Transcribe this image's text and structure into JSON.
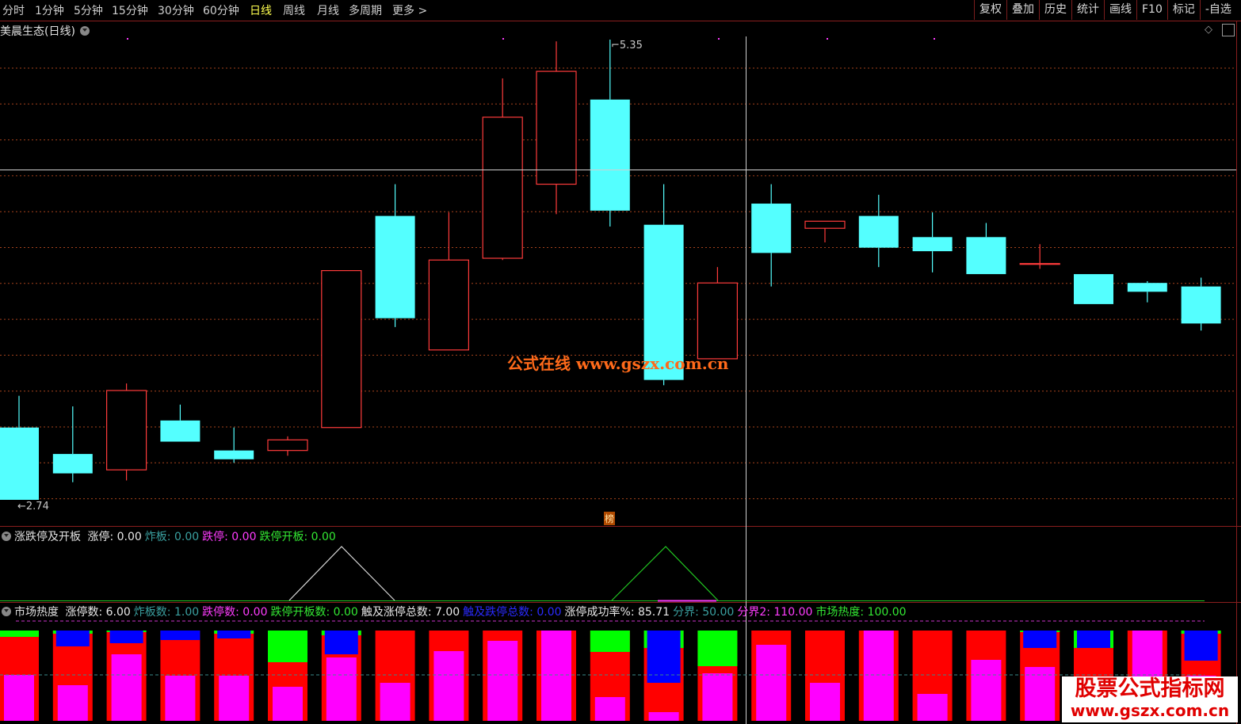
{
  "toolbar": {
    "periods": [
      "分时",
      "1分钟",
      "5分钟",
      "15分钟",
      "30分钟",
      "60分钟",
      "日线",
      "周线",
      "月线",
      "多周期",
      "更多 >"
    ],
    "active_index": 6,
    "right_buttons": [
      "复权",
      "叠加",
      "历史",
      "统计",
      "画线",
      "F10",
      "标记",
      "-自选"
    ]
  },
  "main": {
    "stock_title": "美晨生态(日线)",
    "high_label": "5.35",
    "low_label": "2.74",
    "watermark": "公式在线  www.gszx.com.cn",
    "badge": "榜",
    "colors": {
      "up": "#ff3b3b",
      "down": "#54ffff",
      "grid": "#a5421c"
    }
  },
  "candles": [
    {
      "o": 3.15,
      "c": 2.74,
      "h": 3.33,
      "l": 2.74
    },
    {
      "o": 3.0,
      "c": 2.89,
      "h": 3.27,
      "l": 2.84
    },
    {
      "o": 2.91,
      "c": 3.36,
      "h": 3.4,
      "l": 2.85
    },
    {
      "o": 3.19,
      "c": 3.07,
      "h": 3.28,
      "l": 3.07
    },
    {
      "o": 3.02,
      "c": 2.97,
      "h": 3.15,
      "l": 2.95
    },
    {
      "o": 3.02,
      "c": 3.08,
      "h": 3.1,
      "l": 2.99
    },
    {
      "o": 3.15,
      "c": 4.04,
      "h": 4.04,
      "l": 3.15
    },
    {
      "o": 4.35,
      "c": 3.77,
      "h": 4.53,
      "l": 3.72
    },
    {
      "o": 3.59,
      "c": 4.1,
      "h": 4.37,
      "l": 3.59
    },
    {
      "o": 4.11,
      "c": 4.91,
      "h": 5.13,
      "l": 4.1
    },
    {
      "o": 4.53,
      "c": 5.17,
      "h": 5.34,
      "l": 4.36
    },
    {
      "o": 5.01,
      "c": 4.38,
      "h": 5.35,
      "l": 4.29
    },
    {
      "o": 4.3,
      "c": 3.42,
      "h": 4.53,
      "l": 3.39
    },
    {
      "o": 3.54,
      "c": 3.97,
      "h": 4.06,
      "l": 3.54
    },
    {
      "o": 4.42,
      "c": 4.14,
      "h": 4.53,
      "l": 3.95
    },
    {
      "o": 4.28,
      "c": 4.32,
      "h": 4.32,
      "l": 4.2
    },
    {
      "o": 4.35,
      "c": 4.17,
      "h": 4.47,
      "l": 4.06
    },
    {
      "o": 4.23,
      "c": 4.15,
      "h": 4.37,
      "l": 4.03
    },
    {
      "o": 4.23,
      "c": 4.02,
      "h": 4.31,
      "l": 4.02
    },
    {
      "o": 4.08,
      "c": 4.08,
      "h": 4.19,
      "l": 4.05
    },
    {
      "o": 4.02,
      "c": 3.85,
      "h": 4.02,
      "l": 3.85
    },
    {
      "o": 3.97,
      "c": 3.92,
      "h": 3.98,
      "l": 3.86
    },
    {
      "o": 3.95,
      "c": 3.74,
      "h": 4.0,
      "l": 3.7
    }
  ],
  "indicator1": {
    "name": "涨跌停及开板",
    "items": [
      {
        "label": "涨停: ",
        "value": "0.00",
        "color": "#e8e8e8"
      },
      {
        "label": "炸板: ",
        "value": "0.00",
        "color": "#3aa0a0"
      },
      {
        "label": "跌停: ",
        "value": "0.00",
        "color": "#ff3cff"
      },
      {
        "label": "跌停开板: ",
        "value": "0.00",
        "color": "#33e833"
      }
    ]
  },
  "indicator2": {
    "name": "市场热度",
    "items": [
      {
        "label": "涨停数: ",
        "value": "6.00",
        "color": "#e8e8e8"
      },
      {
        "label": "炸板数: ",
        "value": "1.00",
        "color": "#3aa0a0"
      },
      {
        "label": "跌停数: ",
        "value": "0.00",
        "color": "#ff3cff"
      },
      {
        "label": "跌停开板数: ",
        "value": "0.00",
        "color": "#33e833"
      },
      {
        "label": "触及涨停总数: ",
        "value": "7.00",
        "color": "#e8e8e8"
      },
      {
        "label": "触及跌停总数: ",
        "value": "0.00",
        "color": "#2a2aff"
      },
      {
        "label": "涨停成功率%: ",
        "value": "85.71",
        "color": "#e8e8e8"
      },
      {
        "label": "分界: ",
        "value": "50.00",
        "color": "#3aa0a0"
      },
      {
        "label": "分界2: ",
        "value": "110.00",
        "color": "#ff3cff"
      },
      {
        "label": "市场热度: ",
        "value": "100.00",
        "color": "#33e833"
      }
    ],
    "bars": [
      {
        "g": 8,
        "b": 0,
        "m": 58
      },
      {
        "g": 4,
        "b": 20,
        "m": 45
      },
      {
        "g": 2,
        "b": 16,
        "m": 84
      },
      {
        "g": 0,
        "b": 12,
        "m": 57
      },
      {
        "g": 4,
        "b": 10,
        "m": 57
      },
      {
        "g": 40,
        "b": 0,
        "m": 43
      },
      {
        "g": 6,
        "b": 30,
        "m": 80
      },
      {
        "g": 0,
        "b": 0,
        "m": 48
      },
      {
        "g": 0,
        "b": 0,
        "m": 88
      },
      {
        "g": 0,
        "b": 0,
        "m": 101
      },
      {
        "g": 0,
        "b": 0,
        "m": 114
      },
      {
        "g": 27,
        "b": 0,
        "m": 30
      },
      {
        "g": 22,
        "b": 66,
        "m": 11
      },
      {
        "g": 45,
        "b": 0,
        "m": 60
      },
      {
        "g": 0,
        "b": 0,
        "m": 96
      },
      {
        "g": 0,
        "b": 0,
        "m": 48
      },
      {
        "g": 0,
        "b": 0,
        "m": 114
      },
      {
        "g": 0,
        "b": 0,
        "m": 34
      },
      {
        "g": 0,
        "b": 0,
        "m": 77
      },
      {
        "g": 2,
        "b": 22,
        "m": 68
      },
      {
        "g": 22,
        "b": 22,
        "m": 54
      },
      {
        "g": 0,
        "b": 0,
        "m": 114
      },
      {
        "g": 4,
        "b": 38,
        "m": 57
      }
    ]
  },
  "watermark_bottom": {
    "line1": "股票公式指标网",
    "line2": "www.gszx.com.cn"
  }
}
